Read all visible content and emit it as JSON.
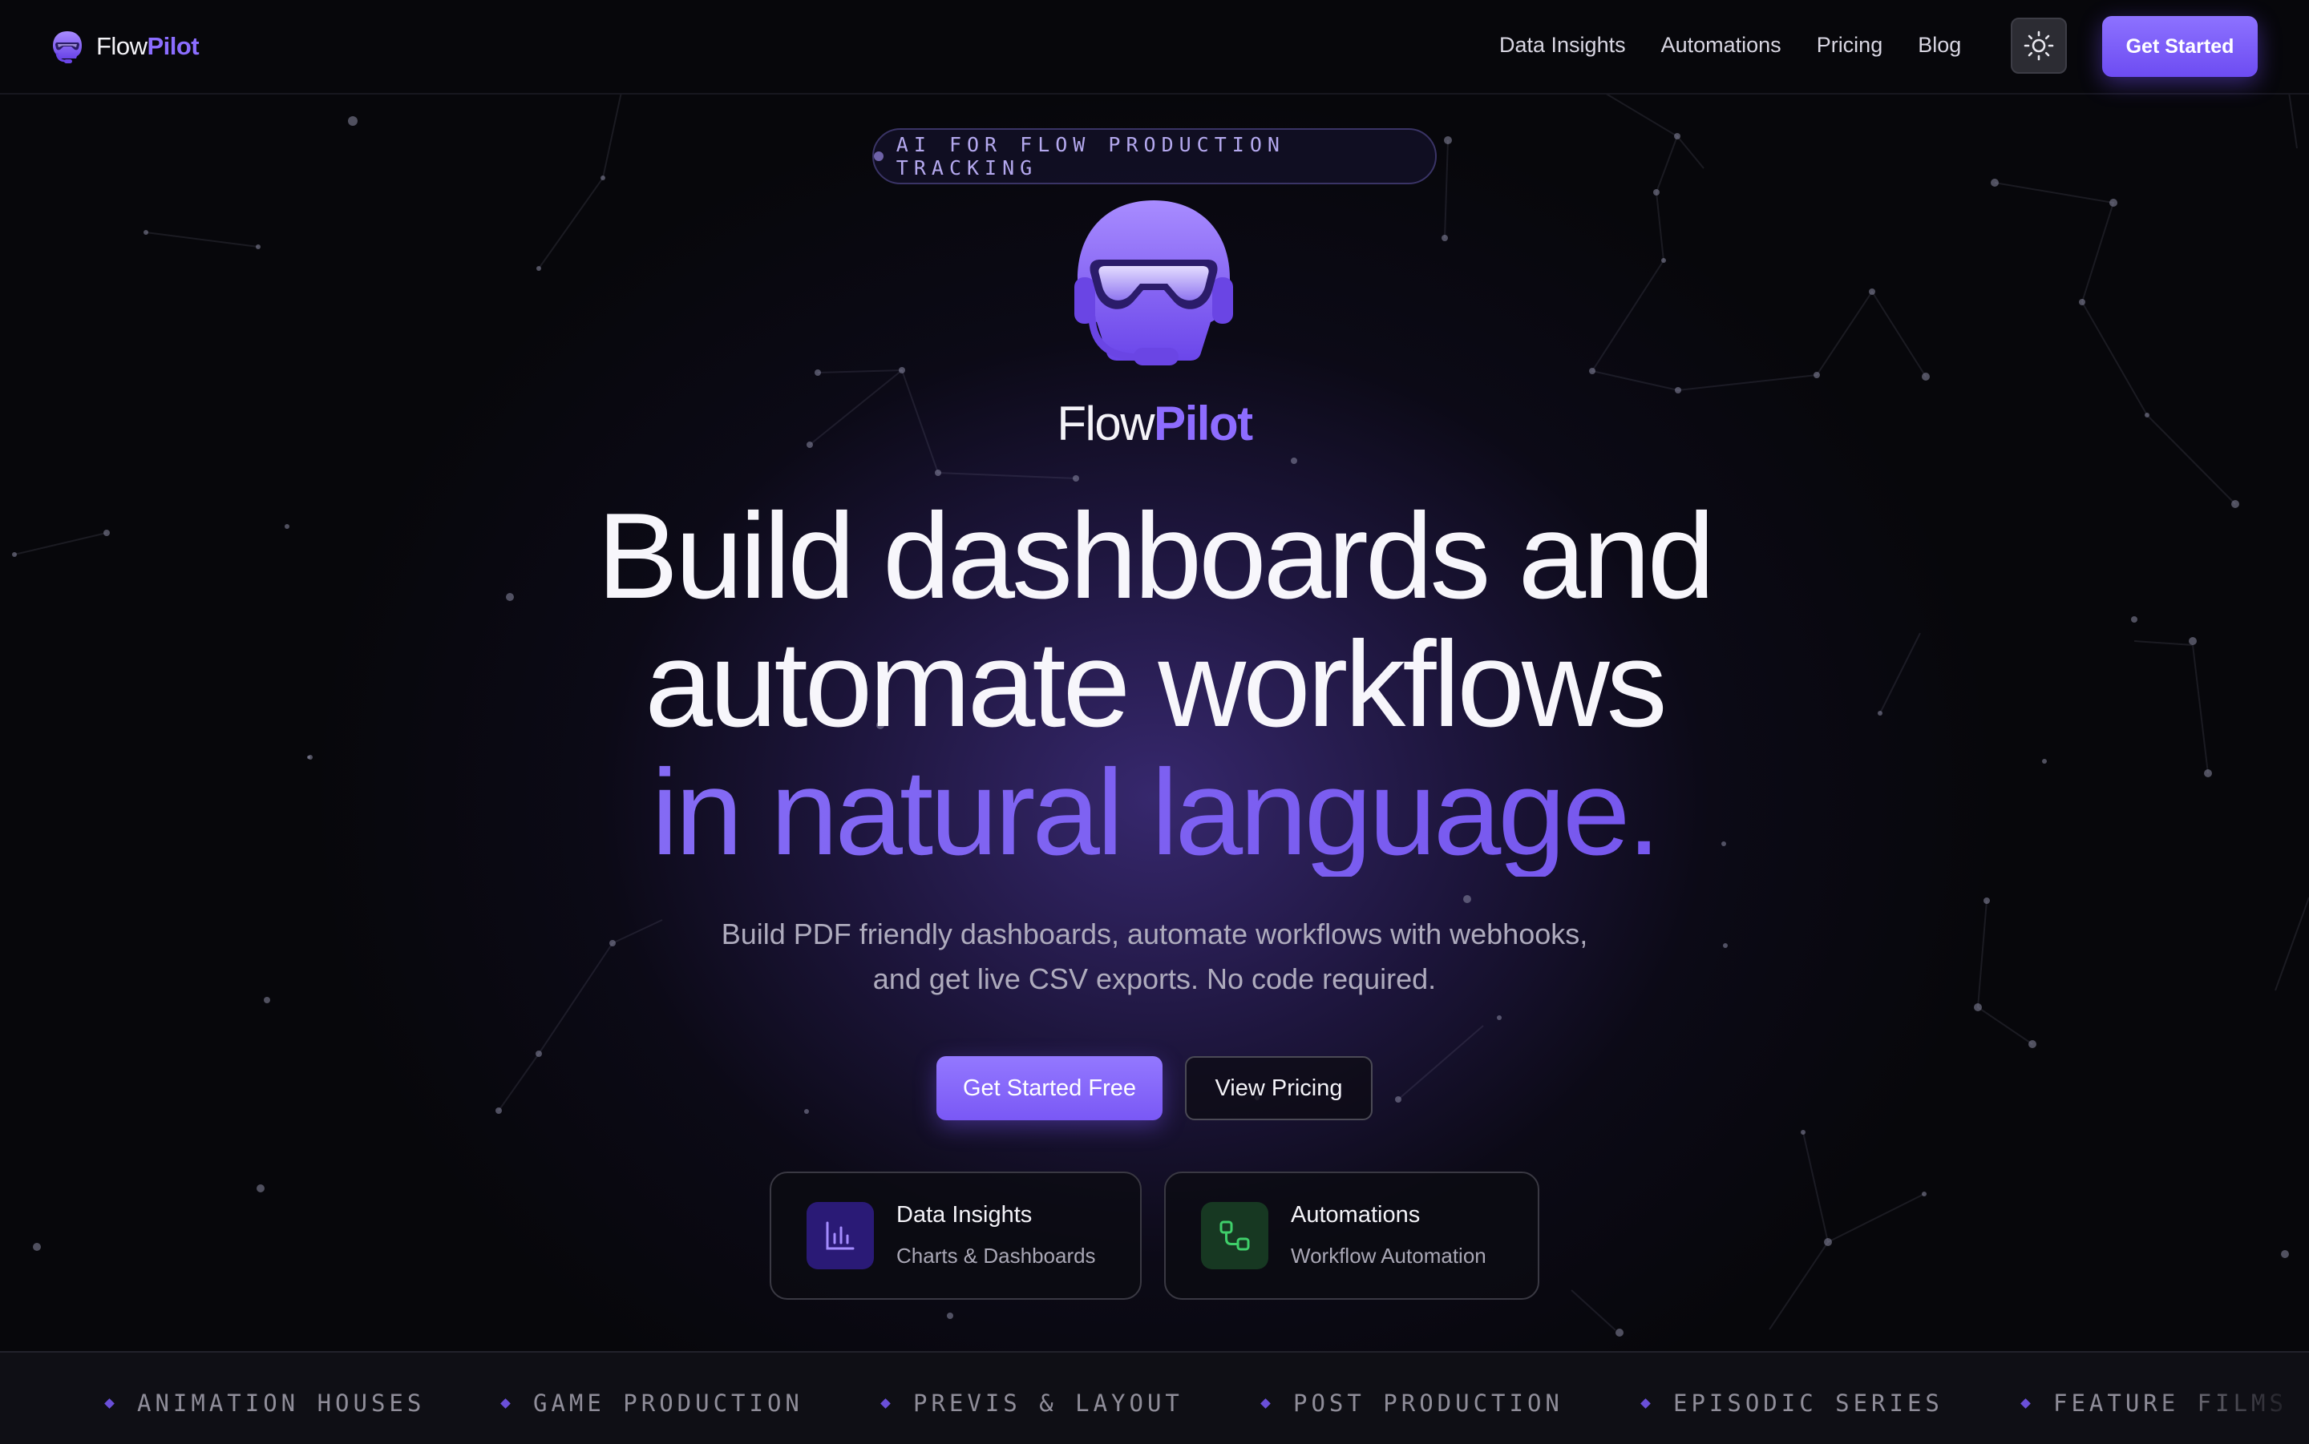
{
  "nav": {
    "brand_name": "Flow",
    "brand_accent": "Pilot",
    "links": [
      {
        "label": "Data Insights"
      },
      {
        "label": "Automations"
      },
      {
        "label": "Pricing"
      },
      {
        "label": "Blog"
      }
    ],
    "theme_toggle_icon": "sun-icon",
    "cta_label": "Get Started"
  },
  "hero": {
    "eyebrow": "AI FOR FLOW PRODUCTION TRACKING",
    "wordmark_name": "Flow",
    "wordmark_accent": "Pilot",
    "headline_line1": "Build dashboards and",
    "headline_line2": "automate workflows",
    "headline_accent": "in natural language.",
    "subhead_line1": "Build PDF friendly dashboards, automate workflows with webhooks,",
    "subhead_line2": "and get live CSV exports. No code required.",
    "primary_button": "Get Started Free",
    "secondary_button": "View Pricing"
  },
  "features": [
    {
      "title": "Data Insights",
      "subtitle": "Charts & Dashboards",
      "icon": "bar-chart-icon"
    },
    {
      "title": "Automations",
      "subtitle": "Workflow Automation",
      "icon": "workflow-icon"
    }
  ],
  "marquee": {
    "items": [
      "ANIMATION HOUSES",
      "GAME PRODUCTION",
      "PREVIS & LAYOUT",
      "POST PRODUCTION",
      "EPISODIC SERIES",
      "FEATURE FILMS"
    ]
  },
  "colors": {
    "accent": "#8b6dff",
    "background": "#07070b",
    "glow": "#3a2a7d"
  }
}
